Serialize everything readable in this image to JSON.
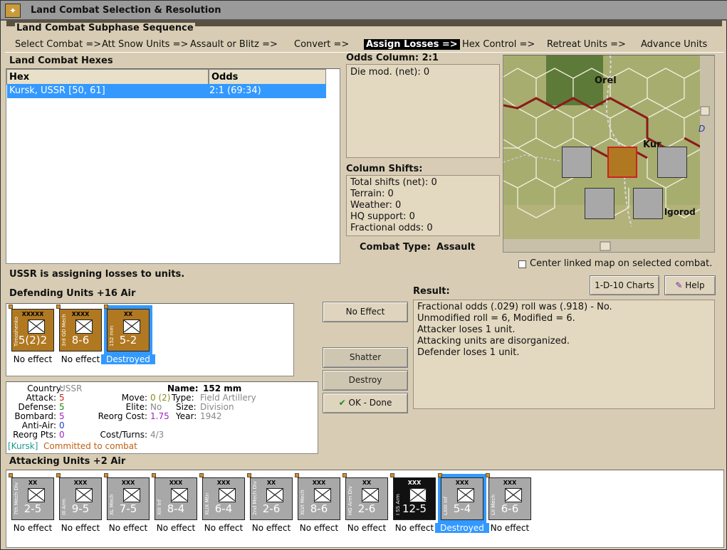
{
  "window": {
    "title": "Land Combat Selection & Resolution",
    "icon_char": "✦"
  },
  "sequence": {
    "header": "Land Combat Subphase Sequence",
    "items": [
      "Select Combat =>",
      "Att Snow Units =>",
      "Assault or Blitz =>",
      "Convert =>",
      "Assign Losses =>",
      "Hex Control =>",
      "Retreat Units =>",
      "Advance Units"
    ],
    "selected_index": 4
  },
  "hexes": {
    "label": "Land Combat Hexes",
    "col_hex": "Hex",
    "col_odds": "Odds",
    "rows": [
      {
        "hex": "Kursk, USSR [50, 61]",
        "odds": "2:1 (69:34)"
      }
    ]
  },
  "odds": {
    "label": "Odds Column: 2:1",
    "die_mod": "Die mod. (net): 0"
  },
  "shifts": {
    "label": "Column Shifts:",
    "lines": [
      "Total shifts (net): 0",
      "Terrain: 0",
      "Weather: 0",
      "HQ support: 0",
      "Fractional odds: 0"
    ]
  },
  "combat_type": {
    "label": "Combat Type:",
    "value": "Assault"
  },
  "map": {
    "label_orel": "Orel",
    "label_kursk": "Kur",
    "label_belgorod": "lgorod",
    "label_d": "D"
  },
  "center_checkbox": "Center linked map on selected combat.",
  "status": "USSR is assigning losses to units.",
  "buttons": {
    "charts": "1-D-10 Charts",
    "help": "Help",
    "no_effect": "No Effect",
    "shatter": "Shatter",
    "destroy": "Destroy",
    "ok_done": "OK - Done"
  },
  "defending": {
    "label": "Defending Units +16 Air",
    "units": [
      {
        "name": "Timoshenko",
        "size": "XXXXX",
        "value": "5(2)2",
        "result": "No effect",
        "color": "#b07820"
      },
      {
        "name": "3rd GD Mech",
        "size": "XXXX",
        "value": "8-6",
        "result": "No effect",
        "color": "#b07820"
      },
      {
        "name": "152 mm",
        "size": "XX",
        "value": "5-2",
        "result": "Destroyed",
        "color": "#b07820"
      }
    ]
  },
  "result": {
    "label": "Result:",
    "lines": [
      "Fractional odds (.029) roll was (.918)  - No.",
      "Unmodified roll = 6, Modified = 6.",
      "Attacker loses 1 unit.",
      "Attacking units are disorganized.",
      "Defender loses 1 unit."
    ]
  },
  "details": {
    "country_label": "Country:",
    "country": "USSR",
    "attack_label": "Attack:",
    "attack": "5",
    "defense_label": "Defense:",
    "defense": "5",
    "bombard_label": "Bombard:",
    "bombard": "5",
    "antiair_label": "Anti-Air:",
    "antiair": "0",
    "reorg_pts_label": "Reorg Pts:",
    "reorg_pts": "0",
    "name_label": "Name:",
    "name": "152 mm",
    "move_label": "Move:",
    "move": "0 (2)",
    "type_label": "Type:",
    "type": "Field Artillery",
    "elite_label": "Elite:",
    "elite": "No",
    "size_label": "Size:",
    "size": "Division",
    "reorg_cost_label": "Reorg Cost:",
    "reorg_cost": "1.75",
    "year_label": "Year:",
    "year": "1942",
    "cost_turns_label": "Cost/Turns:",
    "cost_turns": "4/3",
    "hex_tag": "[Kursk]",
    "committed": "Committed to combat"
  },
  "attacking": {
    "label": "Attacking Units +2 Air",
    "units": [
      {
        "name": "7th Mech Div",
        "size": "XX",
        "value": "2-5",
        "result": "No effect",
        "color": "#a8a8a8"
      },
      {
        "name": "III Arm",
        "size": "XXX",
        "value": "9-5",
        "result": "No effect",
        "color": "#a8a8a8"
      },
      {
        "name": "XL Mech",
        "size": "XXX",
        "value": "7-5",
        "result": "No effect",
        "color": "#a8a8a8"
      },
      {
        "name": "XIII Inf",
        "size": "XXX",
        "value": "8-4",
        "result": "No effect",
        "color": "#a8a8a8"
      },
      {
        "name": "XLIX Mtn",
        "size": "XXX",
        "value": "6-4",
        "result": "No effect",
        "color": "#a8a8a8"
      },
      {
        "name": "2nd Mech Div",
        "size": "XX",
        "value": "2-6",
        "result": "No effect",
        "color": "#a8a8a8"
      },
      {
        "name": "XLVI Mech",
        "size": "XXX",
        "value": "8-6",
        "result": "No effect",
        "color": "#a8a8a8"
      },
      {
        "name": "HG Arm Div",
        "size": "XX",
        "value": "2-6",
        "result": "No effect",
        "color": "#a8a8a8"
      },
      {
        "name": "I SS Arm",
        "size": "XXX",
        "value": "12-5",
        "result": "No effect",
        "color": "#111111"
      },
      {
        "name": "LXIII Inf",
        "size": "XXX",
        "value": "5-4",
        "result": "Destroyed",
        "color": "#a8a8a8"
      },
      {
        "name": "LII Mech",
        "size": "XXX",
        "value": "6-6",
        "result": "No effect",
        "color": "#a8a8a8"
      }
    ]
  }
}
